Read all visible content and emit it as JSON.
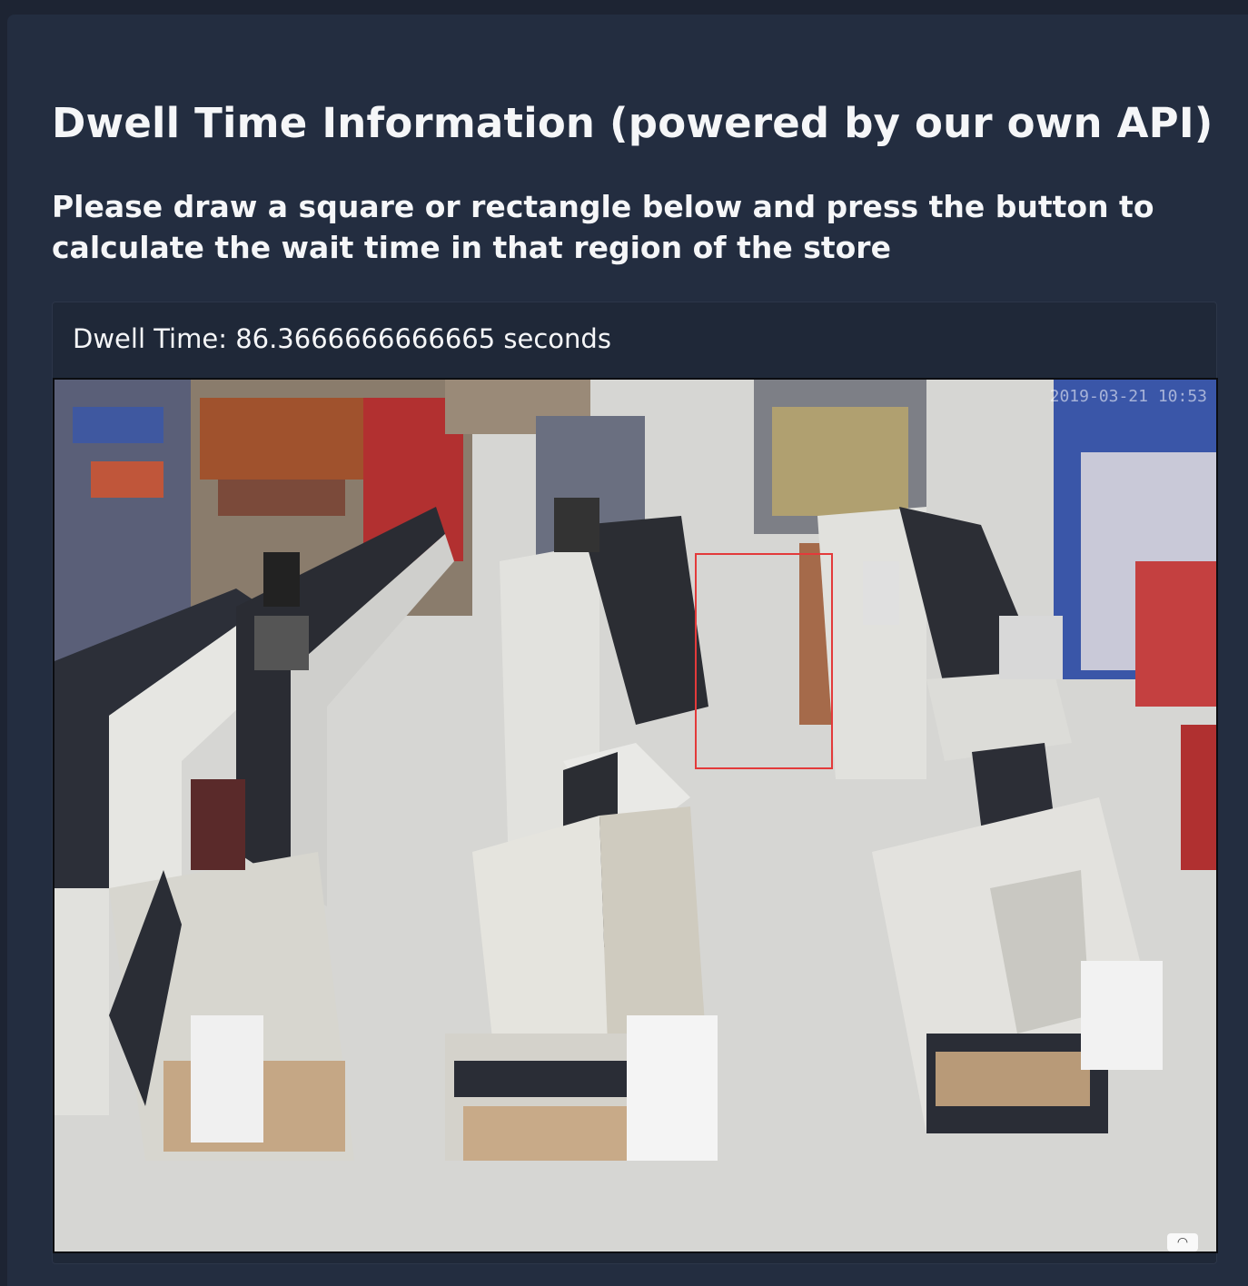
{
  "header": {
    "title": "Dwell Time Information (powered by our own API)",
    "instructions": "Please draw a square or rectangle below and press the button to calculate the wait time in that region of the store"
  },
  "result": {
    "label": "Dwell Time:",
    "value": "86.3666666666665",
    "unit": "seconds"
  },
  "camera": {
    "timestamp": "2019-03-21 10:53",
    "selection_color": "#e33a3a",
    "corner_icon": "camera-logo-icon"
  },
  "colors": {
    "page_background": "#1d2433",
    "panel_background": "#232d40",
    "text": "#f5f6f8"
  }
}
